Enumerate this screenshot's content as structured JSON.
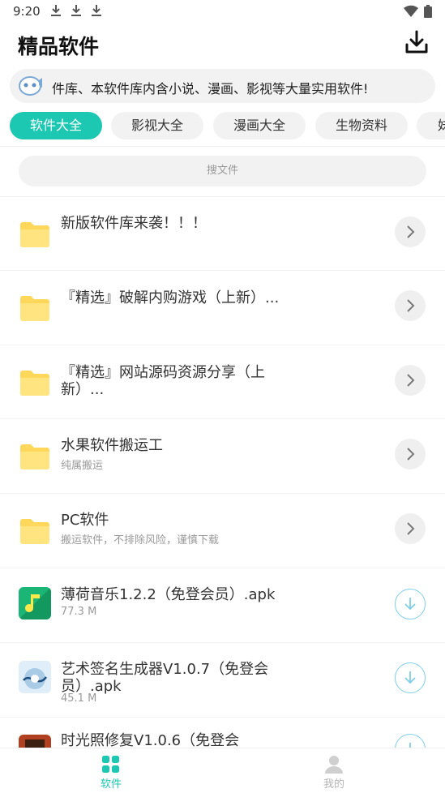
{
  "status": {
    "time": "9:20"
  },
  "header": {
    "title": "精品软件"
  },
  "notice": {
    "text": "件库、本软件库内含小说、漫画、影视等大量实用软件!"
  },
  "tabs": [
    {
      "label": "软件大全",
      "active": true
    },
    {
      "label": "影视大全"
    },
    {
      "label": "漫画大全"
    },
    {
      "label": "生物资料"
    },
    {
      "label": "妹"
    }
  ],
  "search": {
    "placeholder": "搜文件"
  },
  "folders": [
    {
      "title": "新版软件库来袭！！！",
      "subtitle": ""
    },
    {
      "title": "『精选』破解内购游戏（上新）...",
      "subtitle": ""
    },
    {
      "title": "『精选』网站源码资源分享（上新）...",
      "subtitle": ""
    },
    {
      "title": "水果软件搬运工",
      "subtitle": "纯属搬运"
    },
    {
      "title": "PC软件",
      "subtitle": "搬运软件，不排除风险，谨慎下载"
    }
  ],
  "files": [
    {
      "title": "薄荷音乐1.2.2（免登会员）.apk",
      "size": "77.3 M"
    },
    {
      "title": "艺术签名生成器V1.0.7（免登会员）.apk",
      "size": "45.1 M"
    },
    {
      "title": "时光照修复V1.0.6（免登会",
      "size": ""
    }
  ],
  "bottom_nav": [
    {
      "label": "软件",
      "active": true
    },
    {
      "label": "我的",
      "active": false
    }
  ],
  "colors": {
    "accent": "#1cc8b1",
    "folder": "#ffd75a",
    "download": "#7fcfe8"
  }
}
